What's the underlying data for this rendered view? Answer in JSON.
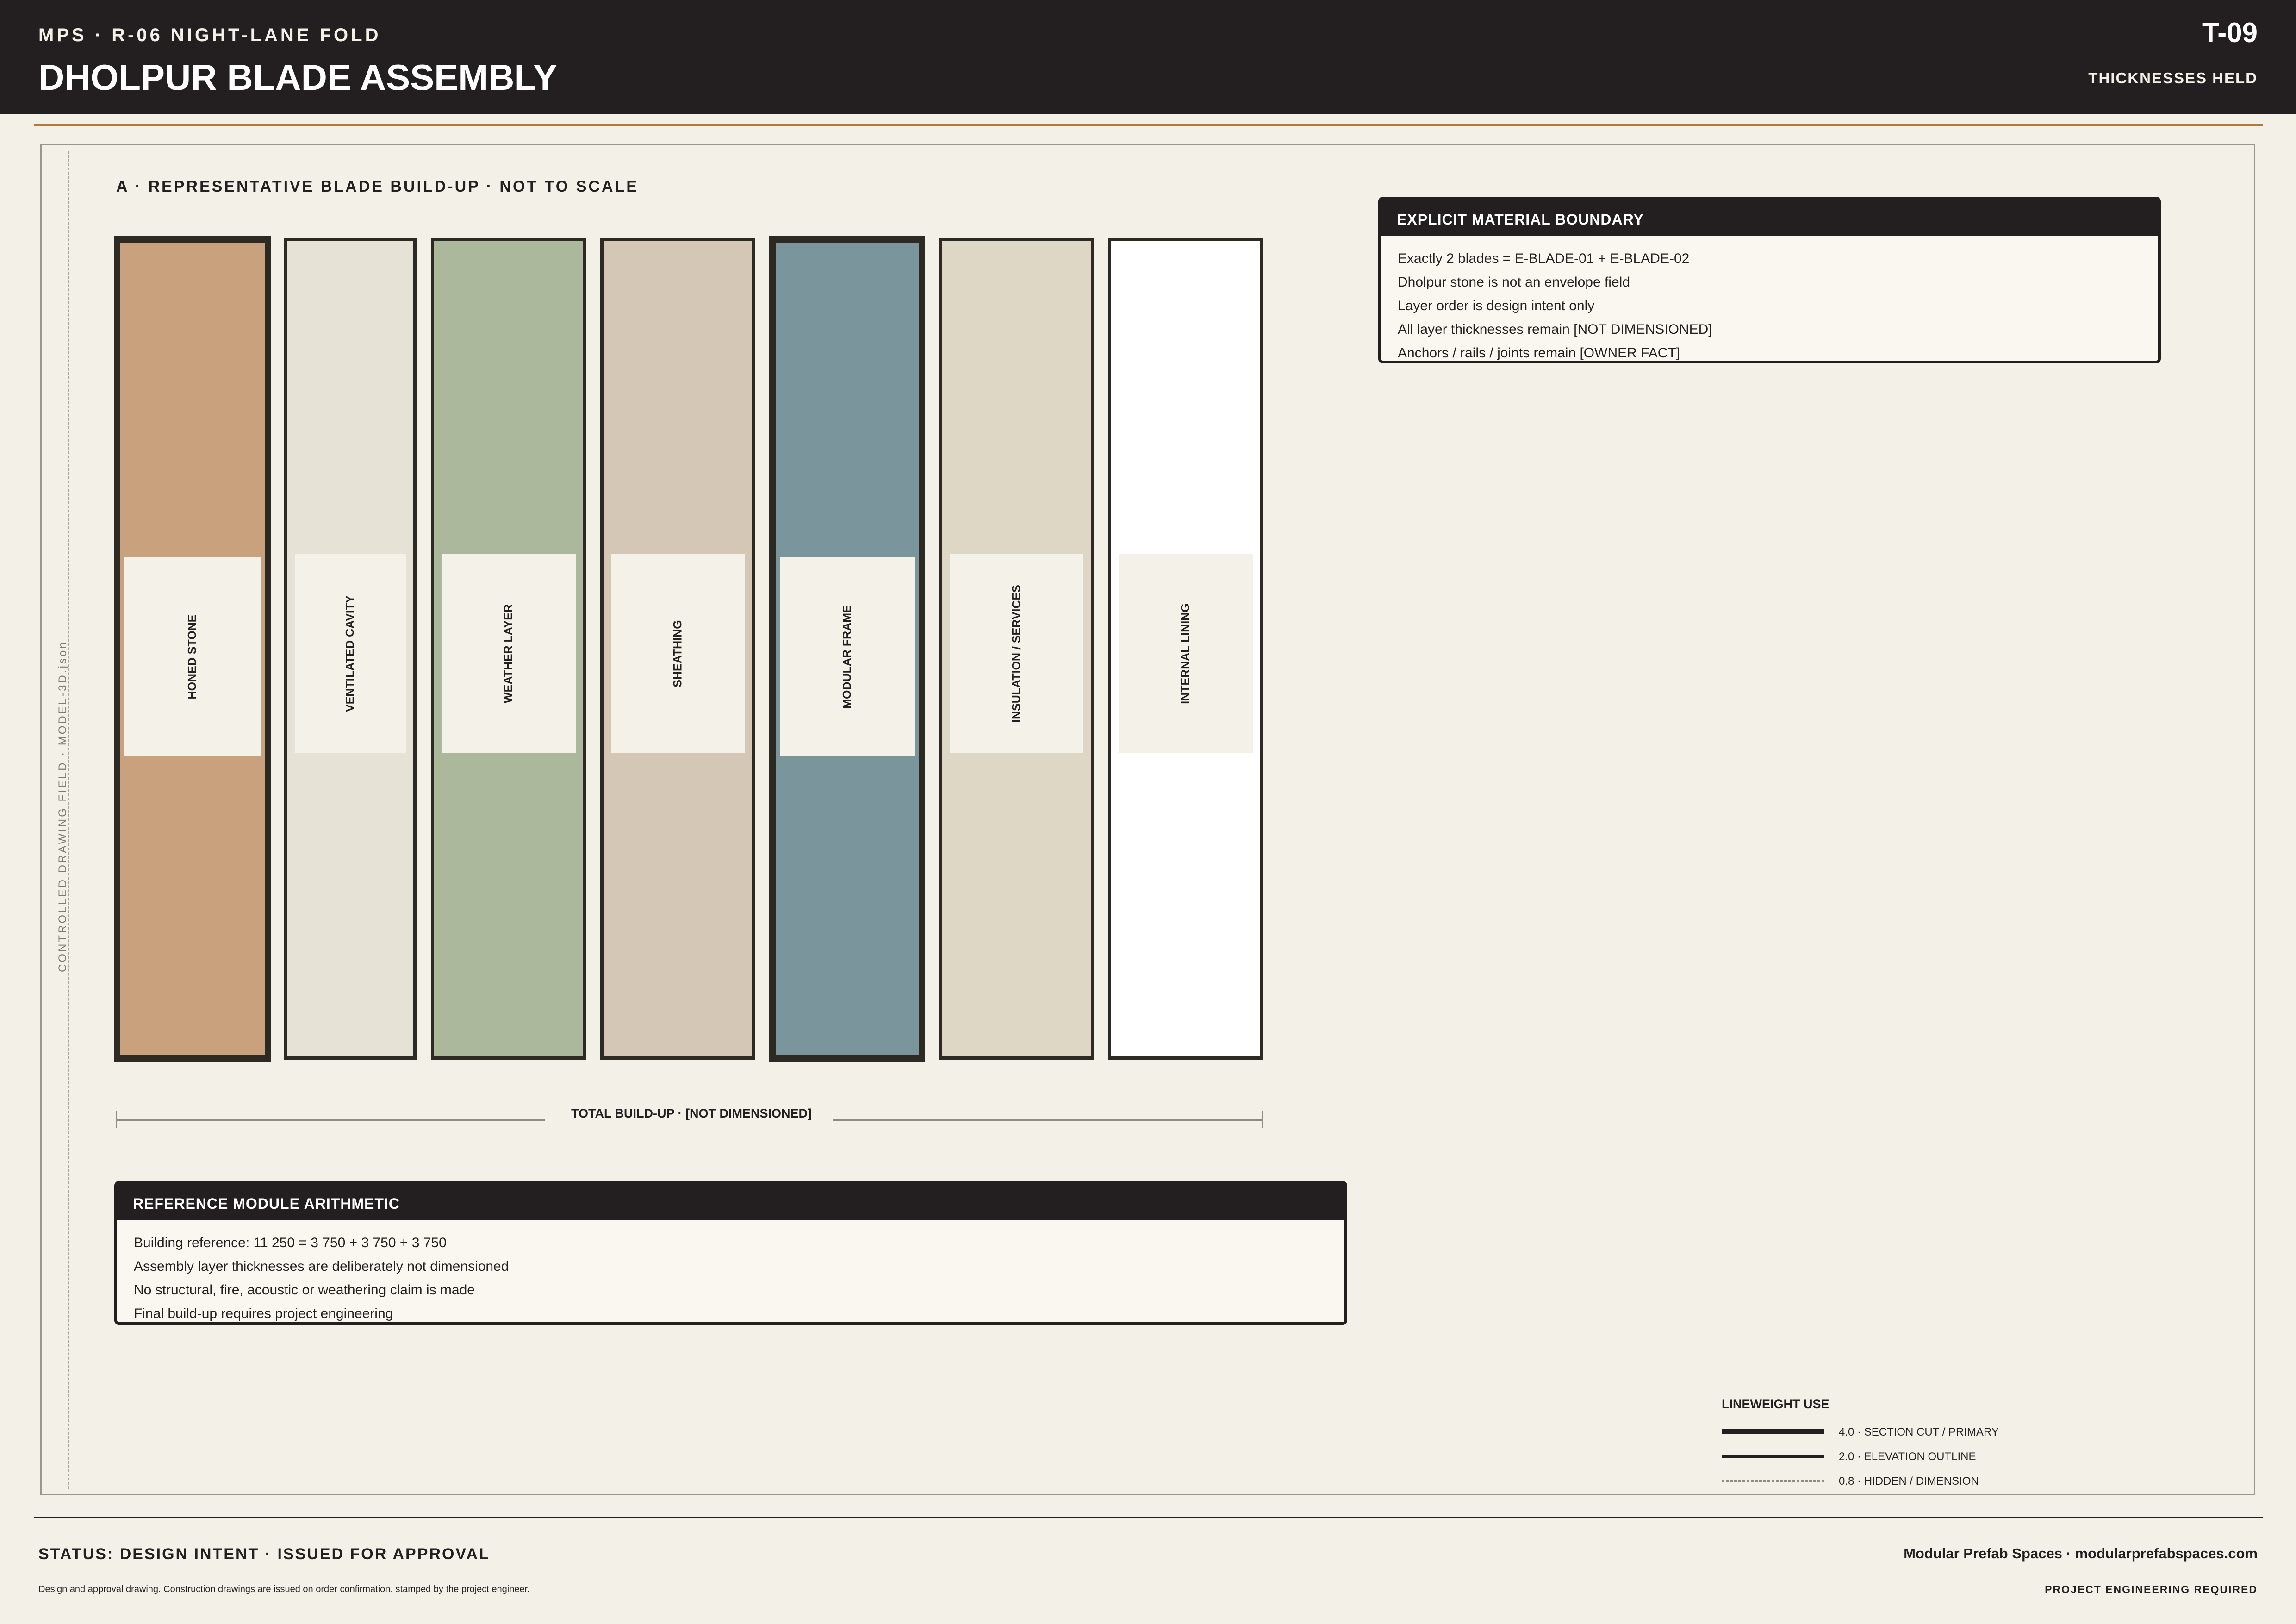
{
  "header": {
    "project_line": "MPS · R-06 NIGHT-LANE FOLD",
    "title": "DHOLPUR BLADE ASSEMBLY",
    "sheet_number": "T-09",
    "sheet_status": "THICKNESSES HELD"
  },
  "side_label": "CONTROLLED DRAWING FIELD · MODEL-3D.json",
  "section_heading": "A · REPRESENTATIVE BLADE BUILD-UP · NOT TO SCALE",
  "blades": [
    {
      "label": "HONED STONE",
      "fill": "#c9a27d",
      "weight": "primary"
    },
    {
      "label": "VENTILATED CAVITY",
      "fill": "#e6e2d6",
      "weight": "outline"
    },
    {
      "label": "WEATHER LAYER",
      "fill": "#abb89c",
      "weight": "outline"
    },
    {
      "label": "SHEATHING",
      "fill": "#d4c7b6",
      "weight": "outline"
    },
    {
      "label": "MODULAR FRAME",
      "fill": "#7a969c",
      "weight": "primary"
    },
    {
      "label": "INSULATION / SERVICES",
      "fill": "#ded7c6",
      "weight": "outline"
    },
    {
      "label": "INTERNAL LINING",
      "fill": "#ffffff",
      "weight": "outline"
    }
  ],
  "dimension_label": "TOTAL BUILD-UP · [NOT DIMENSIONED]",
  "boundary_panel": {
    "title": "EXPLICIT MATERIAL BOUNDARY",
    "lines": [
      "Exactly 2 blades = E-BLADE-01 + E-BLADE-02",
      "Dholpur stone is not an envelope field",
      "Layer order is design intent only",
      "All layer thicknesses remain [NOT DIMENSIONED]",
      "Anchors / rails / joints remain [OWNER FACT]"
    ]
  },
  "arithmetic_panel": {
    "title": "REFERENCE MODULE ARITHMETIC",
    "lines": [
      "Building reference: 11 250 = 3 750 + 3 750 + 3 750",
      "Assembly layer thicknesses are deliberately not dimensioned",
      "No structural, fire, acoustic or weathering claim is made",
      "Final build-up requires project engineering"
    ]
  },
  "legend": {
    "title": "LINEWEIGHT USE",
    "items": [
      {
        "label": "4.0 · SECTION CUT / PRIMARY",
        "style": "solid"
      },
      {
        "label": "2.0 · ELEVATION OUTLINE",
        "style": "solid"
      },
      {
        "label": "0.8 · HIDDEN / DIMENSION",
        "style": "dashed"
      }
    ]
  },
  "footer": {
    "status": "STATUS: DESIGN INTENT · ISSUED FOR APPROVAL",
    "note": "Design and approval drawing. Construction drawings are issued on order confirmation, stamped by the project engineer.",
    "company": "Modular Prefab Spaces · modularprefabspaces.com",
    "engineering": "PROJECT ENGINEERING REQUIRED"
  }
}
